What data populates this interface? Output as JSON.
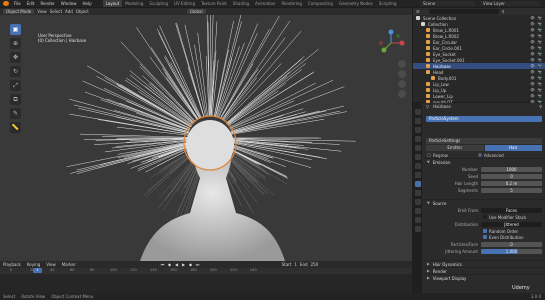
{
  "menu": {
    "items": [
      "File",
      "Edit",
      "Render",
      "Window",
      "Help"
    ],
    "workspaces": [
      "Layout",
      "Modeling",
      "Sculpting",
      "UV Editing",
      "Texture Paint",
      "Shading",
      "Animation",
      "Rendering",
      "Compositing",
      "Geometry Nodes",
      "Scripting"
    ],
    "active_workspace": "Layout",
    "scene": "Scene",
    "view_layer": "View Layer"
  },
  "viewport": {
    "mode": "Object Mode",
    "view_menus": [
      "View",
      "Select",
      "Add",
      "Object"
    ],
    "orientation": "Global",
    "info_line1": "User Perspective",
    "info_line2": "(0) Collection | Hairbase",
    "tool_icons": [
      "select-box-icon",
      "cursor-icon",
      "move-icon",
      "rotate-icon",
      "scale-icon",
      "transform-icon",
      "annotate-icon",
      "measure-icon"
    ]
  },
  "timeline": {
    "menus": [
      "Playback",
      "Keying",
      "View",
      "Marker"
    ],
    "current_frame": "1",
    "ruler": [
      "0",
      "20",
      "40",
      "60",
      "80",
      "100",
      "120",
      "140",
      "160",
      "180",
      "200",
      "220",
      "240"
    ],
    "start_label": "Start",
    "start": "1",
    "end_label": "End",
    "end": "250"
  },
  "status": {
    "items": [
      "Select",
      "Rotate View",
      "Object Context Menu"
    ],
    "version": "3.0.0"
  },
  "outliner": {
    "title": "Scene Collection",
    "rows": [
      {
        "name": "Scene Collection",
        "icon_color": "#d4d4d4",
        "depth": 0,
        "selected": false
      },
      {
        "name": "Collection",
        "icon_color": "#d4d4d4",
        "depth": 1,
        "selected": false
      },
      {
        "name": "Brow_L.R001",
        "icon_color": "#e0a04c",
        "depth": 2,
        "selected": false
      },
      {
        "name": "Brow_L.R002",
        "icon_color": "#e0a04c",
        "depth": 2,
        "selected": false
      },
      {
        "name": "Ear_Circular",
        "icon_color": "#e0a04c",
        "depth": 2,
        "selected": false
      },
      {
        "name": "Ear_Circle.001",
        "icon_color": "#e0a04c",
        "depth": 2,
        "selected": false
      },
      {
        "name": "Eye_Socket",
        "icon_color": "#e0a04c",
        "depth": 2,
        "selected": false
      },
      {
        "name": "Eye_Socket.001",
        "icon_color": "#e0a04c",
        "depth": 2,
        "selected": false
      },
      {
        "name": "Hairbase",
        "icon_color": "#e0a04c",
        "depth": 2,
        "selected": true
      },
      {
        "name": "Head",
        "icon_color": "#e0a04c",
        "depth": 2,
        "selected": false
      },
      {
        "name": "Body.001",
        "icon_color": "#e0a04c",
        "depth": 3,
        "selected": false
      },
      {
        "name": "Lip_Low",
        "icon_color": "#e0a04c",
        "depth": 2,
        "selected": false
      },
      {
        "name": "Lip_Up",
        "icon_color": "#e0a04c",
        "depth": 2,
        "selected": false
      },
      {
        "name": "Lower_Lip",
        "icon_color": "#e0a04c",
        "depth": 2,
        "selected": false
      },
      {
        "name": "mouth.DT",
        "icon_color": "#e0a04c",
        "depth": 2,
        "selected": false
      }
    ]
  },
  "properties": {
    "object_name": "Hairbase",
    "particle_system_label": "ParticleSystem",
    "settings_name": "ParticleSettings",
    "type_options": [
      "Emitter",
      "Hair"
    ],
    "type_active": "Hair",
    "regrow_label": "Regrow",
    "advanced_label": "Advanced",
    "emission": {
      "title": "Emission",
      "fields": [
        {
          "label": "Number",
          "value": "1000"
        },
        {
          "label": "Seed",
          "value": "0"
        },
        {
          "label": "Hair Length",
          "value": "0.2 m"
        },
        {
          "label": "Segments",
          "value": "5"
        }
      ]
    },
    "source": {
      "title": "Source",
      "emit_from_label": "Emit From",
      "emit_from": "Faces",
      "use_modifier_stack": "Use Modifier Stack",
      "distribution_label": "Distribution",
      "distribution": "Jittered",
      "random_order": "Random Order",
      "even_distribution": "Even Distribution",
      "particles_face_label": "Particles/Face",
      "particles_face": "0",
      "jittering_label": "Jittering Amount",
      "jittering": "1.000"
    },
    "collapsed_sections": [
      "Hair Dynamics",
      "Render",
      "Viewport Display"
    ]
  },
  "watermark": "Udemy"
}
